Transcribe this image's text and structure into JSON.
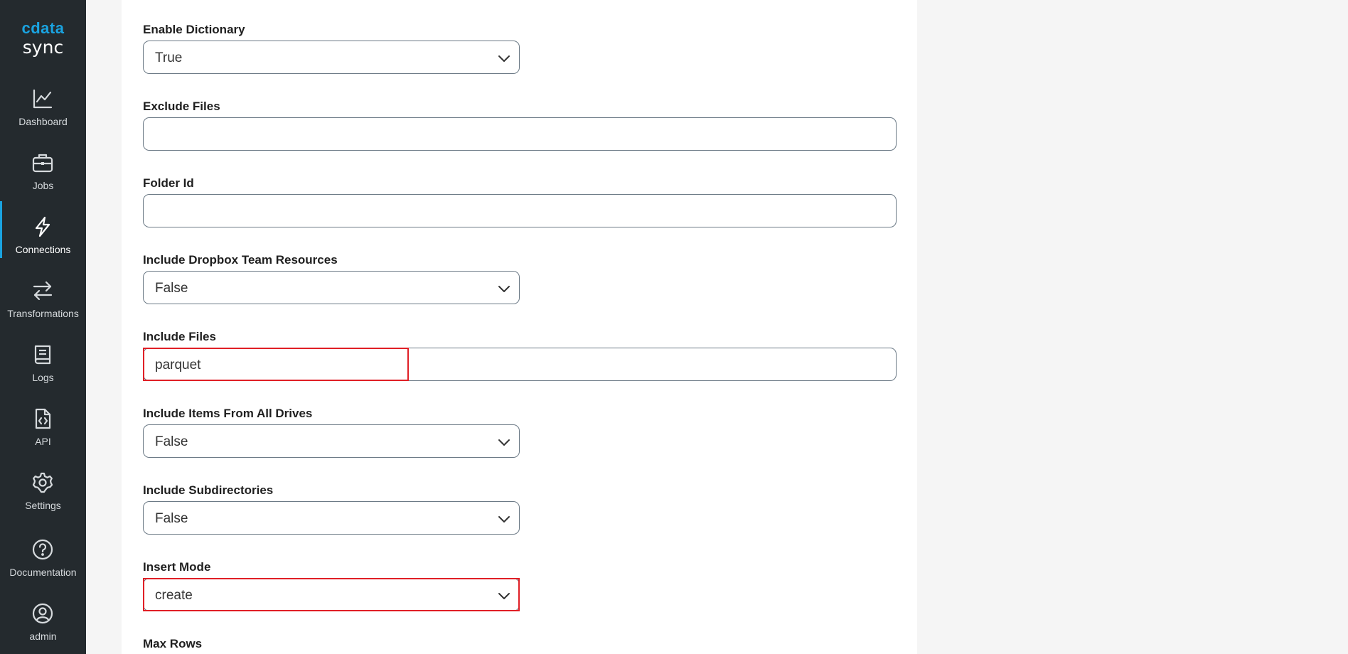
{
  "logo": {
    "brand": "cdata",
    "product": "sync"
  },
  "nav": [
    {
      "label": "Dashboard",
      "icon": "chart-line-icon",
      "active": false
    },
    {
      "label": "Jobs",
      "icon": "briefcase-icon",
      "active": false
    },
    {
      "label": "Connections",
      "icon": "lightning-icon",
      "active": true
    },
    {
      "label": "Transformations",
      "icon": "arrows-exchange-icon",
      "active": false
    },
    {
      "label": "Logs",
      "icon": "book-icon",
      "active": false
    },
    {
      "label": "API",
      "icon": "code-file-icon",
      "active": false
    },
    {
      "label": "Settings",
      "icon": "gear-icon",
      "active": false
    },
    {
      "label": "Documentation",
      "icon": "help-circle-icon",
      "active": false
    },
    {
      "label": "admin",
      "icon": "user-circle-icon",
      "active": false
    }
  ],
  "form": {
    "enable_dictionary": {
      "label": "Enable Dictionary",
      "value": "True"
    },
    "exclude_files": {
      "label": "Exclude Files",
      "value": ""
    },
    "folder_id": {
      "label": "Folder Id",
      "value": ""
    },
    "include_dropbox_team_resources": {
      "label": "Include Dropbox Team Resources",
      "value": "False"
    },
    "include_files": {
      "label": "Include Files",
      "value": "parquet"
    },
    "include_items_from_all_drives": {
      "label": "Include Items From All Drives",
      "value": "False"
    },
    "include_subdirectories": {
      "label": "Include Subdirectories",
      "value": "False"
    },
    "insert_mode": {
      "label": "Insert Mode",
      "value": "create"
    },
    "max_rows": {
      "label": "Max Rows"
    }
  },
  "colors": {
    "sidebar_bg": "#242a2e",
    "accent": "#1aa3e0",
    "highlight": "#e01f26"
  }
}
